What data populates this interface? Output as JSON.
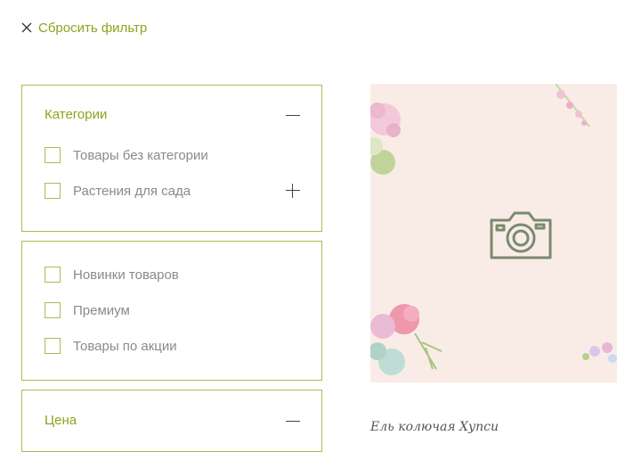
{
  "reset_filter": {
    "label": "Сбросить фильтр",
    "icon": "close-icon"
  },
  "filters": {
    "categories": {
      "title": "Категории",
      "items": [
        {
          "label": "Товары без категории",
          "checked": false
        },
        {
          "label": "Растения для сада",
          "checked": false,
          "expandable": true
        }
      ]
    },
    "tags": {
      "items": [
        {
          "label": "Новинки товаров",
          "checked": false
        },
        {
          "label": "Премиум",
          "checked": false
        },
        {
          "label": "Товары по акции",
          "checked": false
        }
      ]
    },
    "price": {
      "title": "Цена"
    }
  },
  "product": {
    "name": "Ель колючая Хупси",
    "placeholder_icon": "camera-icon"
  },
  "colors": {
    "accent": "#8aa51e",
    "border": "#a9bd50",
    "placeholder_bg": "#f9ece6",
    "camera": "#7b8a6f"
  }
}
